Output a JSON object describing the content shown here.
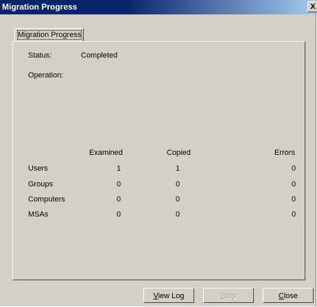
{
  "window": {
    "title": "Migration Progress",
    "close_glyph": "X"
  },
  "tab": {
    "label": "Migration Progress"
  },
  "status": {
    "label": "Status:",
    "value": "Completed"
  },
  "operation": {
    "label": "Operation:",
    "value": ""
  },
  "table": {
    "headers": [
      "Examined",
      "Copied",
      "Errors"
    ],
    "rows": [
      {
        "label": "Users",
        "examined": "1",
        "copied": "1",
        "errors": "0"
      },
      {
        "label": "Groups",
        "examined": "0",
        "copied": "0",
        "errors": "0"
      },
      {
        "label": "Computers",
        "examined": "0",
        "copied": "0",
        "errors": "0"
      },
      {
        "label": "MSAs",
        "examined": "0",
        "copied": "0",
        "errors": "0"
      }
    ]
  },
  "buttons": {
    "view_log_first": "V",
    "view_log_rest": "iew Log",
    "stop_first": "S",
    "stop_rest": "top",
    "close_first": "C",
    "close_rest": "lose"
  }
}
